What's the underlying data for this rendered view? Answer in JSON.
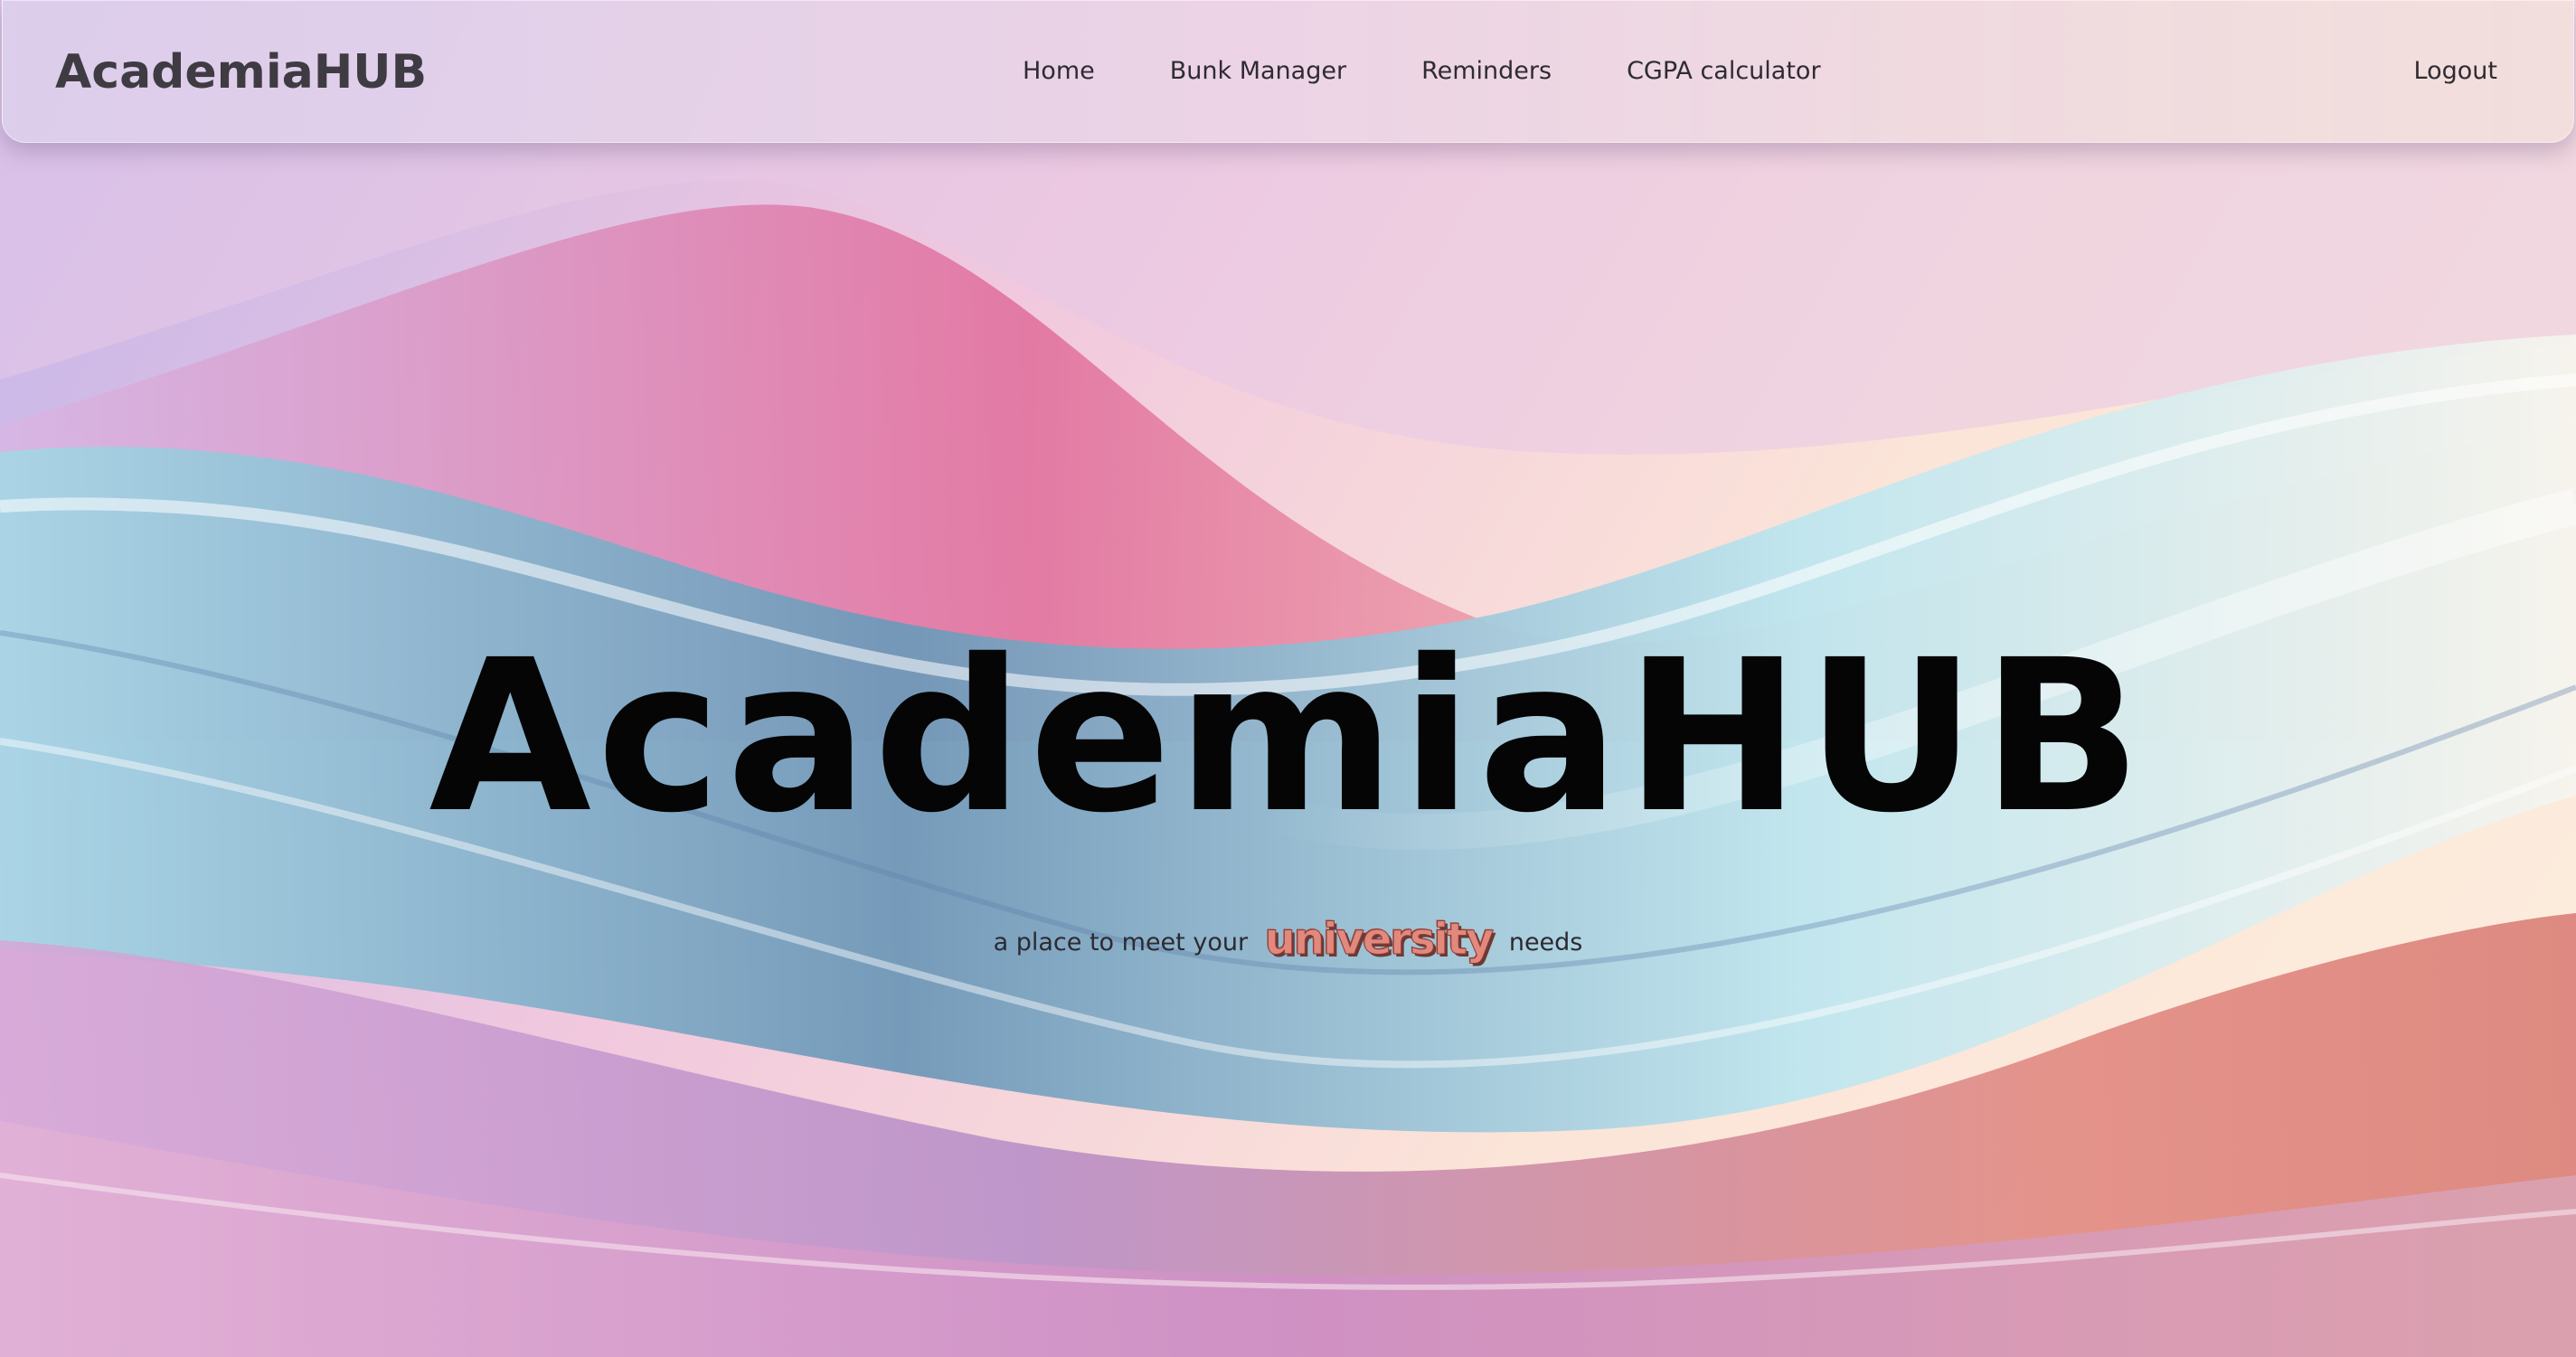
{
  "navbar": {
    "brand": "AcademiaHUB",
    "links": [
      "Home",
      "Bunk Manager",
      "Reminders",
      "CGPA calculator"
    ],
    "logout": "Logout"
  },
  "hero": {
    "title": "AcademiaHUB",
    "tagline_before": "a place to meet your",
    "tagline_highlight": "university",
    "tagline_after": "needs"
  },
  "colors": {
    "text_dark": "#050505",
    "nav_text": "#2f2b33",
    "highlight": "#e2887d",
    "highlight_shadow": "#6b3a35"
  }
}
